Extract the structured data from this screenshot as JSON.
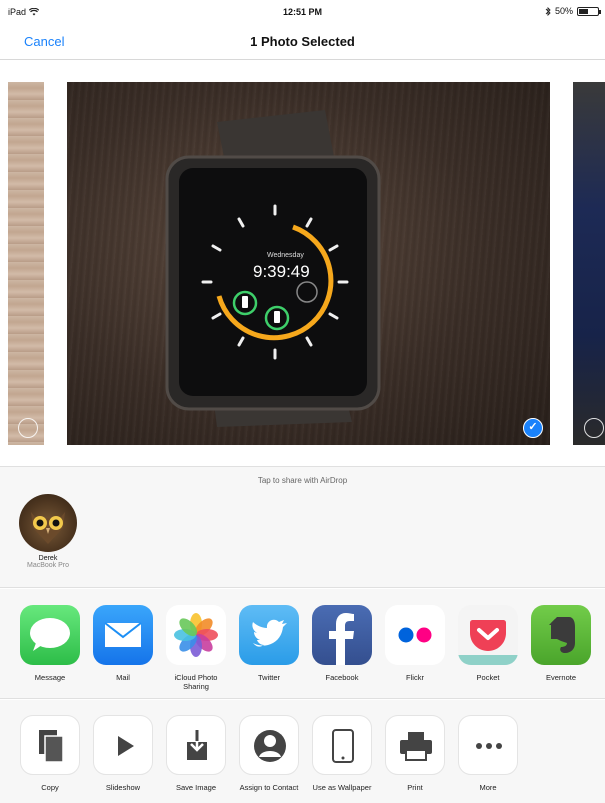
{
  "status_bar": {
    "device": "iPad",
    "time": "12:51 PM",
    "battery_text": "50%",
    "battery_level": 0.5
  },
  "nav": {
    "cancel_label": "Cancel",
    "title": "1 Photo Selected"
  },
  "photos": {
    "items": [
      {
        "selected": false
      },
      {
        "selected": true
      },
      {
        "selected": false
      }
    ]
  },
  "airdrop": {
    "hint": "Tap to share with AirDrop",
    "people": [
      {
        "name": "Derek",
        "device": "MacBook Pro"
      }
    ]
  },
  "share_apps": [
    {
      "label": "Message",
      "icon": "message-icon",
      "color": "#4cd964"
    },
    {
      "label": "Mail",
      "icon": "mail-icon",
      "color": "#1d8ff5"
    },
    {
      "label": "iCloud Photo Sharing",
      "icon": "photos-icon",
      "color": "#ffffff"
    },
    {
      "label": "Twitter",
      "icon": "twitter-icon",
      "color": "#55acee"
    },
    {
      "label": "Facebook",
      "icon": "facebook-icon",
      "color": "#3b5998"
    },
    {
      "label": "Flickr",
      "icon": "flickr-icon",
      "color": "#ffffff"
    },
    {
      "label": "Pocket",
      "icon": "pocket-icon",
      "color": "#ef4056"
    },
    {
      "label": "Evernote",
      "icon": "evernote-icon",
      "color": "#5fb936"
    }
  ],
  "actions": [
    {
      "label": "Copy",
      "icon": "copy-icon"
    },
    {
      "label": "Slideshow",
      "icon": "play-icon"
    },
    {
      "label": "Save Image",
      "icon": "save-image-icon"
    },
    {
      "label": "Assign to Contact",
      "icon": "contact-icon"
    },
    {
      "label": "Use as Wallpaper",
      "icon": "wallpaper-icon"
    },
    {
      "label": "Print",
      "icon": "printer-icon"
    },
    {
      "label": "More",
      "icon": "more-icon"
    }
  ],
  "colors": {
    "accent": "#1a82fb"
  }
}
